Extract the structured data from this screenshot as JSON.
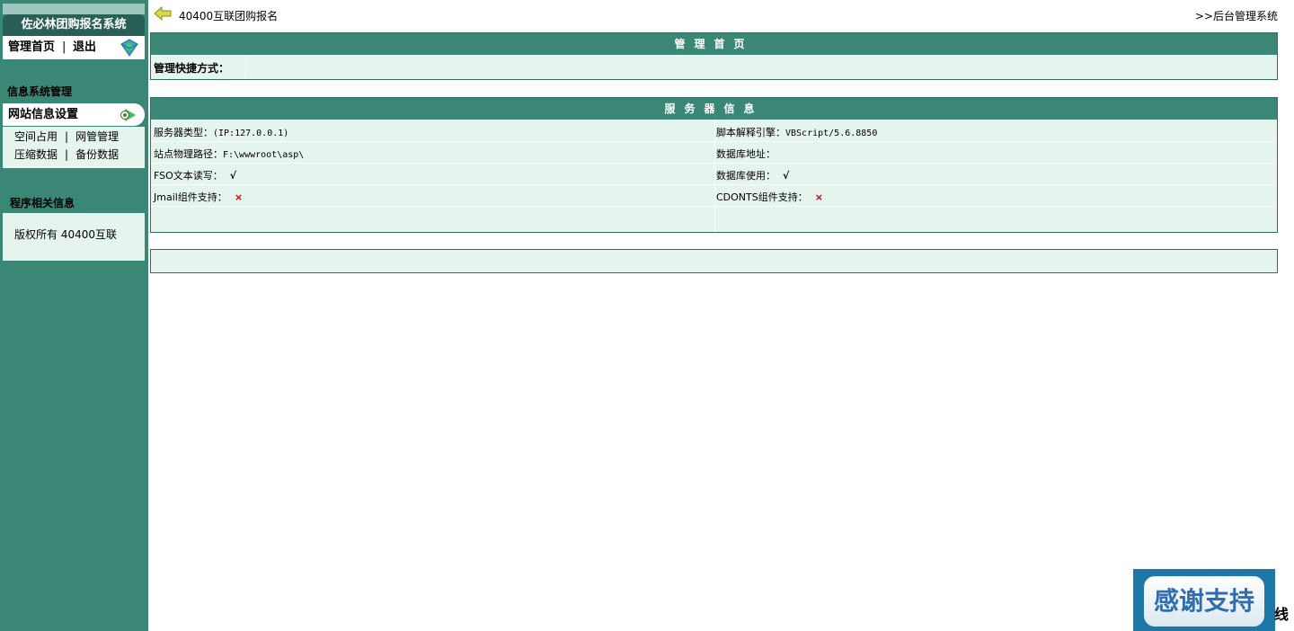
{
  "sidebar": {
    "system_title": "佐必林团购报名系统",
    "home_link": "管理首页",
    "separator": "|",
    "exit_link": "退出",
    "section_info_mgmt": "信息系统管理",
    "menu_site_settings": "网站信息设置",
    "submenu": {
      "space_usage": "空间占用",
      "network_mgmt": "网管管理",
      "compress_data": "压缩数据",
      "backup_data": "备份数据"
    },
    "section_program_info": "程序相关信息",
    "copyright": "版权所有 40400互联"
  },
  "topbar": {
    "breadcrumb": "40400互联团购报名",
    "right_link": ">>后台管理系统"
  },
  "panel_home": {
    "title": "管理首页",
    "shortcut_label": "管理快捷方式："
  },
  "panel_server": {
    "title": "服务器信息",
    "rows": [
      {
        "left_label": "服务器类型：",
        "left_value": "(IP:127.0.0.1)",
        "right_label": "脚本解释引擎：",
        "right_value": "VBScript/5.6.8850"
      },
      {
        "left_label": "站点物理路径：",
        "left_value": "F:\\wwwroot\\asp\\",
        "right_label": "数据库地址：",
        "right_value": ""
      },
      {
        "left_label": "FSO文本读写：",
        "left_value": "√",
        "right_label": "数据库使用：",
        "right_value": "√"
      },
      {
        "left_label": "Jmail组件支持：",
        "left_value": "×",
        "right_label": "CDONTS组件支持：",
        "right_value": "×"
      }
    ]
  },
  "badge": {
    "text": "感谢支持",
    "edge_char": "线"
  },
  "colors": {
    "sidebar_bg": "#3b8775",
    "header_bg": "#3b8775",
    "panel_bg": "#e6f4ee",
    "error_mark": "#d40000"
  },
  "icons": {
    "back": "back-arrow-icon",
    "home": "globe-icon",
    "settings": "gear-icon"
  }
}
